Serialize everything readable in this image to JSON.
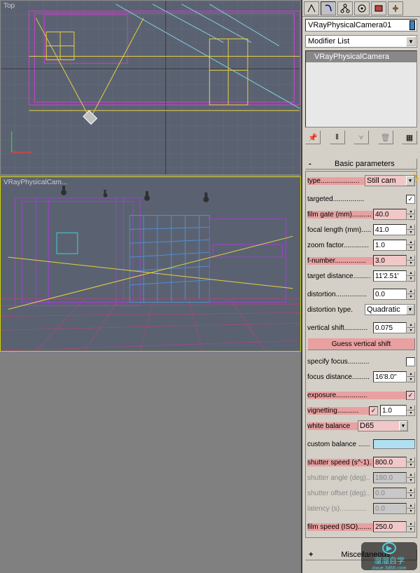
{
  "viewports": {
    "top_label": "Top",
    "bottom_label": "VRayPhysicalCam..."
  },
  "panel": {
    "object_name": "VRayPhysicalCamera01",
    "modifier_list_label": "Modifier List",
    "stack_item": "VRayPhysicalCamera"
  },
  "rollouts": {
    "basic": {
      "title": "Basic parameters"
    },
    "misc": {
      "title": "Miscellaneous"
    }
  },
  "params": {
    "type": {
      "label": "type....................",
      "value": "Still cam"
    },
    "targeted": {
      "label": "targeted................"
    },
    "film_gate": {
      "label": "film gate (mm)..........",
      "value": "40.0"
    },
    "focal_length": {
      "label": "focal length (mm).....",
      "value": "41.0"
    },
    "zoom_factor": {
      "label": "zoom factor.............",
      "value": "1.0"
    },
    "f_number": {
      "label": "f-number................",
      "value": "3.0"
    },
    "target_distance": {
      "label": "target distance.........",
      "value": "11'2.51'"
    },
    "distortion": {
      "label": "distortion................",
      "value": "0.0"
    },
    "distortion_type": {
      "label": "distortion type.",
      "value": "Quadratic"
    },
    "vertical_shift": {
      "label": "vertical shift............",
      "value": "0.075"
    },
    "guess_vshift": {
      "label": "Guess vertical shift"
    },
    "specify_focus": {
      "label": "specify focus..........."
    },
    "focus_distance": {
      "label": "focus distance.........",
      "value": "16'8.0''"
    },
    "exposure": {
      "label": "exposure................"
    },
    "vignetting": {
      "label": "vignetting...........",
      "value": "1.0"
    },
    "white_balance": {
      "label": "white balance",
      "value": "D65"
    },
    "custom_balance": {
      "label": "custom balance ......"
    },
    "shutter_speed": {
      "label": "shutter speed (s^-1).",
      "value": "800.0"
    },
    "shutter_angle": {
      "label": "shutter angle (deg)..",
      "value": "180.0"
    },
    "shutter_offset": {
      "label": "shutter offset (deg)..",
      "value": "0.0"
    },
    "latency": {
      "label": "latency (s)..............",
      "value": "0.0"
    },
    "film_speed": {
      "label": "film speed (ISO).......",
      "value": "250.0"
    }
  },
  "watermark": {
    "line1": "溜溜自学",
    "line2": "zixue.3d66.com"
  }
}
